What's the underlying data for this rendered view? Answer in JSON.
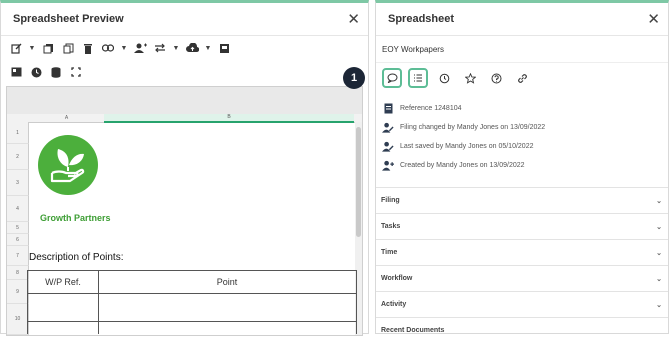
{
  "left_panel": {
    "title": "Spreadsheet Preview",
    "close": "✕",
    "sheet": {
      "col_a": "A",
      "col_b": "B",
      "rows": [
        "1",
        "2",
        "3",
        "4",
        "5",
        "6",
        "7",
        "8",
        "9",
        "10"
      ],
      "brand": "Growth Partners",
      "description": "Description of Points:",
      "table_headers": [
        "W/P Ref.",
        "Point"
      ]
    }
  },
  "right_panel": {
    "title": "Spreadsheet",
    "close": "✕",
    "subtitle": "EOY Workpapers",
    "badge": "1",
    "info": [
      {
        "icon": "document-icon",
        "text": "Reference 1248104"
      },
      {
        "icon": "user-edit-icon",
        "text": "Filing changed by Mandy Jones on 13/09/2022"
      },
      {
        "icon": "user-edit-icon",
        "text": "Last saved by Mandy Jones on 05/10/2022"
      },
      {
        "icon": "user-add-icon",
        "text": "Created by Mandy Jones on 13/09/2022"
      }
    ],
    "sections": [
      "Filing",
      "Tasks",
      "Time",
      "Workflow",
      "Activity",
      "Recent Documents"
    ]
  },
  "colors": {
    "accent": "#7ec8a5",
    "selection": "#27a36d",
    "brand_green": "#4caf3c",
    "badge": "#1c2636"
  }
}
